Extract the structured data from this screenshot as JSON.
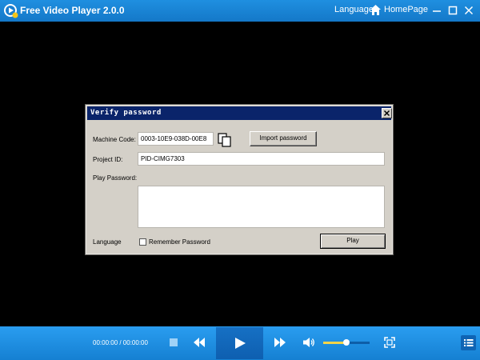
{
  "titlebar": {
    "title": "Free Video Player 2.0.0",
    "language": "Language",
    "homepage": "HomePage"
  },
  "dialog": {
    "title": "Verify password",
    "machine_code_label": "Machine Code:",
    "machine_code_value": "0003-10E9-038D-00E8",
    "import_button": "Import password",
    "project_id_label": "Project ID:",
    "project_id_value": "PID-CIMG7303",
    "play_password_label": "Play Password:",
    "play_password_value": "",
    "language_label": "Language",
    "remember_label": "Remember Password",
    "remember_checked": false,
    "play_button": "Play"
  },
  "controls": {
    "time": "00:00:00 / 00:00:00",
    "volume_level": 0.5
  },
  "colors": {
    "titlebar": "#1f8fe0",
    "dialog_caption": "#0a246a",
    "dialog_bg": "#d4d0c8",
    "volume_fill": "#f4d44a"
  },
  "icons": [
    "app-logo-icon",
    "home-icon",
    "minimize-icon",
    "maximize-icon",
    "close-icon",
    "copy-icon",
    "stop-icon",
    "previous-icon",
    "play-icon",
    "next-icon",
    "volume-icon",
    "fullscreen-icon",
    "playlist-icon"
  ]
}
